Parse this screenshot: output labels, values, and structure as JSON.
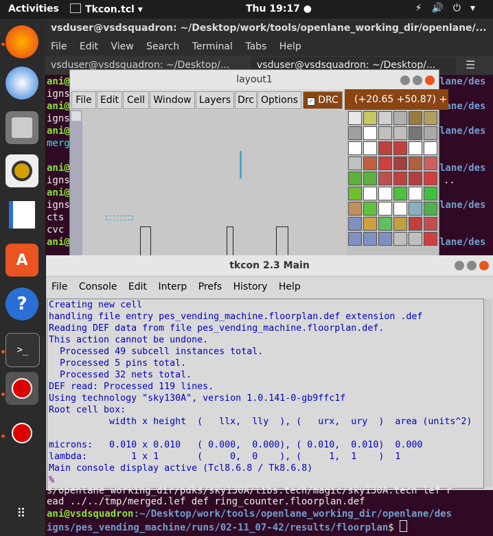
{
  "topbar": {
    "activities": "Activities",
    "app": "Tkcon.tcl ▾",
    "clock": "Thu 19:17 ●",
    "tray": "⚡🔊⏻▾"
  },
  "terminal": {
    "title": "vsduser@vsdsquadron: ~/Desktop/work/tools/openlane_working_dir/openlane/...",
    "menu": [
      "File",
      "Edit",
      "View",
      "Search",
      "Terminal",
      "Tabs",
      "Help"
    ],
    "tab1": "vsduser@vsdsquadron: ~/Desktop/...",
    "tab2": "vsduser@vsdsquadron: ~/Desktop/...",
    "left_fragments": [
      "ani@",
      "igns",
      "ani@",
      "igns",
      "ani@",
      "merg",
      "ani@",
      "igns",
      "ani@",
      "igns",
      "cts",
      "cvc",
      "ani@",
      "igns"
    ],
    "right_fragments": [
      "lane/des",
      "lane/des",
      "lane/des",
      "lane/des",
      "..",
      "lane/des",
      "lane/des"
    ],
    "bottom": {
      "line1": "s/openlane_working_dir/pdks/sky130A/libs.tech/magic/sky130A.tech lef r",
      "line2": "ead ../../tmp/merged.lef def ring_counter.floorplan.def",
      "prompt_user": "ani@vsdsquadron",
      "prompt_path1": ":~/Desktop/work/tools/openlane_working_dir/openlane/des",
      "prompt_path2": "igns/pes_vending_machine/runs/02-11_07-42/results/floorplan",
      "prompt_end": "$ "
    }
  },
  "layout": {
    "title": "layout1",
    "menu": [
      "File",
      "Edit",
      "Cell",
      "Window",
      "Layers",
      "Drc",
      "Options"
    ],
    "drc": "DRC",
    "coords": "(+20.65 +50.87) +"
  },
  "tkcon": {
    "title": "tkcon 2.3 Main",
    "menu": [
      "File",
      "Console",
      "Edit",
      "Interp",
      "Prefs",
      "History",
      "Help"
    ],
    "lines": [
      "Creating new cell",
      "handling file entry pes_vending_machine.floorplan.def extension .def",
      "Reading DEF data from file pes_vending_machine.floorplan.def.",
      "This action cannot be undone.",
      "  Processed 49 subcell instances total.",
      "  Processed 5 pins total.",
      "  Processed 32 nets total.",
      "DEF read: Processed 119 lines.",
      "Using technology \"sky130A\", version 1.0.141-0-gb9ffc1f",
      "Root cell box:",
      "           width x height  (   llx,  lly  ), (   urx,  ury  )  area (units^2)",
      "",
      "microns:   0.010 x 0.010   ( 0.000,  0.000), ( 0.010,  0.010)  0.000",
      "lambda:        1 x 1       (     0,  0    ), (     1,  1    )  1",
      "Main console display active (Tcl8.6.8 / Tk8.6.8)",
      "%"
    ]
  },
  "colors": {
    "accent": "#e95420",
    "console_text": "#0000c0",
    "prompt_green": "#8ae234",
    "path_blue": "#729fcf"
  }
}
